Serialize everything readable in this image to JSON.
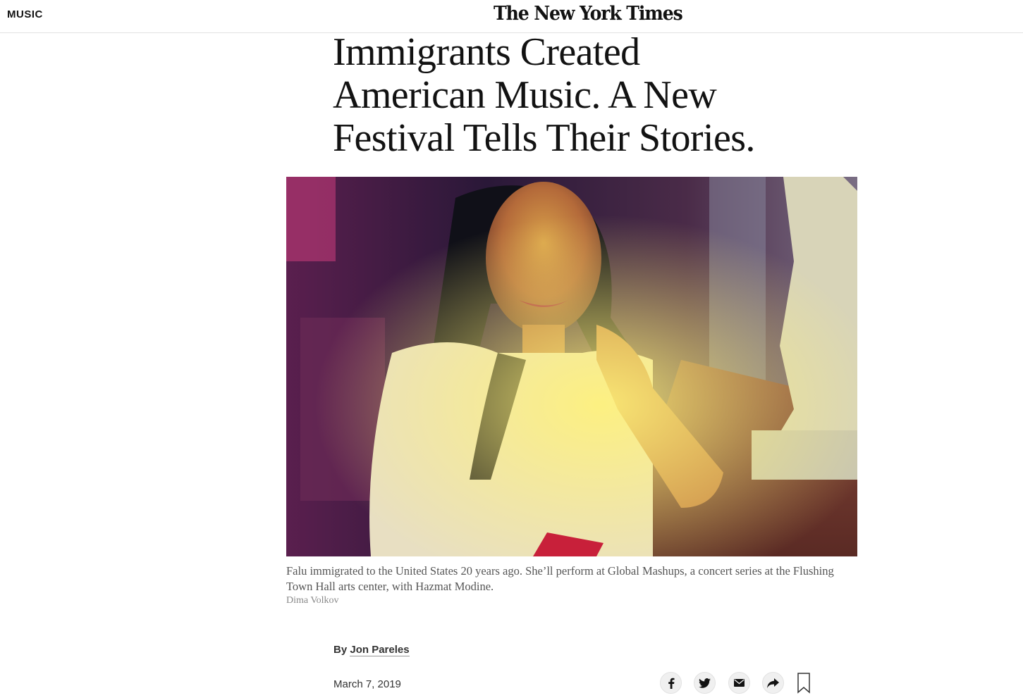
{
  "header": {
    "section_label": "MUSIC",
    "logo_text": "The New York Times"
  },
  "article": {
    "headline": "Immigrants Created American Music. A New Festival Tells Their Stories.",
    "caption": "Falu immigrated to the United States 20 years ago. She’ll perform at Global Mashups, a concert series at the Flushing Town Hall arts center, with Hazmat Modine.",
    "photo_credit": "Dima Volkov",
    "byline_prefix": "By",
    "author": "Jon Pareles",
    "date": "March 7, 2019"
  },
  "share_buttons": [
    {
      "name": "facebook",
      "icon": "facebook-icon"
    },
    {
      "name": "twitter",
      "icon": "twitter-icon"
    },
    {
      "name": "email",
      "icon": "email-icon"
    },
    {
      "name": "share",
      "icon": "share-arrow-icon"
    },
    {
      "name": "save",
      "icon": "bookmark-icon"
    }
  ],
  "colors": {
    "text": "#121212",
    "caption": "#555555",
    "credit": "#888888",
    "divider": "#e2e2e2",
    "button_bg": "#f0f0f0"
  }
}
